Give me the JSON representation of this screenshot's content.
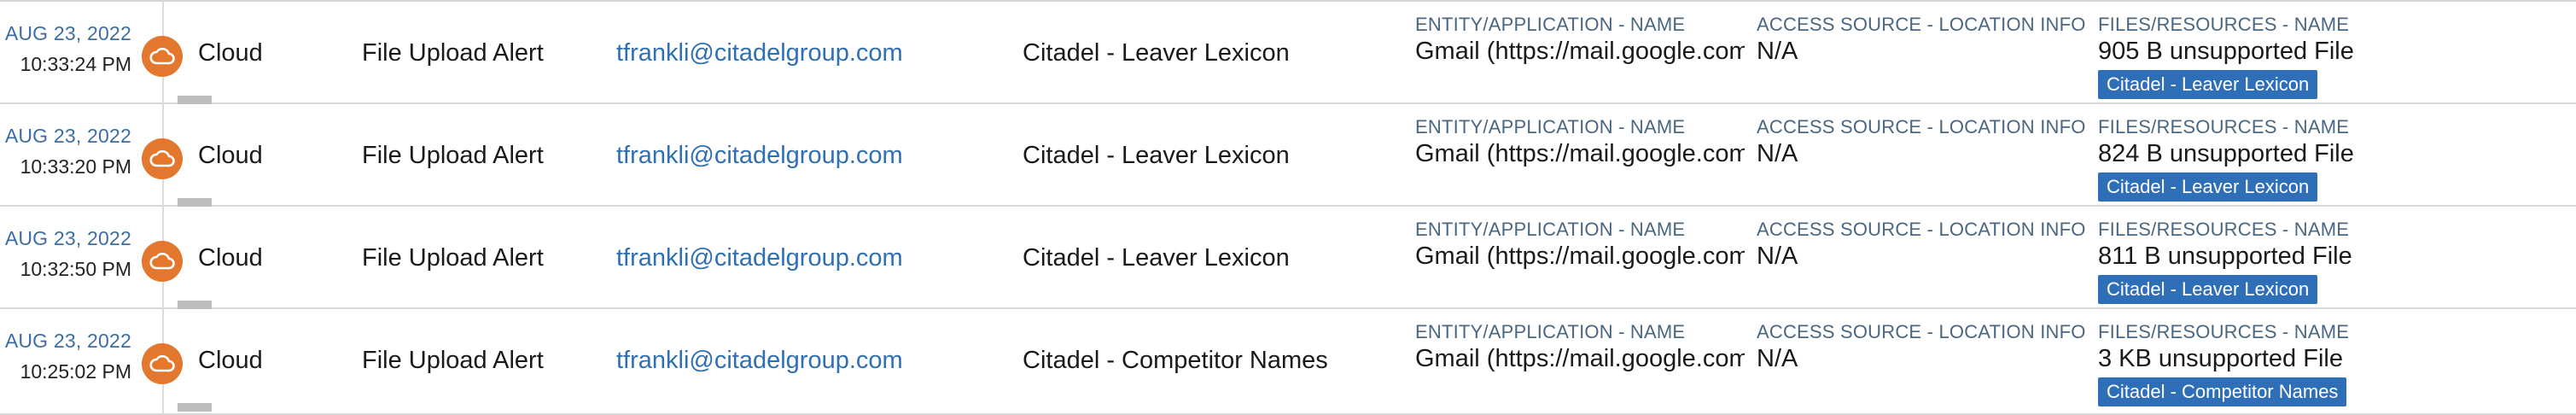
{
  "columns": {
    "entity_label": "ENTITY/APPLICATION - NAME",
    "access_label": "ACCESS SOURCE - LOCATION INFO",
    "files_label": "FILES/RESOURCES - NAME"
  },
  "colors": {
    "source_icon": "#e2772d",
    "date_text": "#3d6ea3",
    "link": "#2f6fb3",
    "tag_bg": "#2f6fb8",
    "field_label": "#4a6782"
  },
  "rows": [
    {
      "date": "AUG 23, 2022",
      "time": "10:33:24 PM",
      "source_icon": "cloud-icon",
      "source": "Cloud",
      "alert_type": "File Upload Alert",
      "user": "tfrankli@citadelgroup.com",
      "policy": "Citadel - Leaver Lexicon",
      "entity": "Gmail (https://mail.google.com",
      "access": "N/A",
      "file": "905 B unsupported File",
      "tag": "Citadel - Leaver Lexicon"
    },
    {
      "date": "AUG 23, 2022",
      "time": "10:33:20 PM",
      "source_icon": "cloud-icon",
      "source": "Cloud",
      "alert_type": "File Upload Alert",
      "user": "tfrankli@citadelgroup.com",
      "policy": "Citadel - Leaver Lexicon",
      "entity": "Gmail (https://mail.google.com",
      "access": "N/A",
      "file": "824 B unsupported File",
      "tag": "Citadel - Leaver Lexicon"
    },
    {
      "date": "AUG 23, 2022",
      "time": "10:32:50 PM",
      "source_icon": "cloud-icon",
      "source": "Cloud",
      "alert_type": "File Upload Alert",
      "user": "tfrankli@citadelgroup.com",
      "policy": "Citadel - Leaver Lexicon",
      "entity": "Gmail (https://mail.google.com",
      "access": "N/A",
      "file": "811 B unsupported File",
      "tag": "Citadel - Leaver Lexicon"
    },
    {
      "date": "AUG 23, 2022",
      "time": "10:25:02 PM",
      "source_icon": "cloud-icon",
      "source": "Cloud",
      "alert_type": "File Upload Alert",
      "user": "tfrankli@citadelgroup.com",
      "policy": "Citadel - Competitor Names",
      "entity": "Gmail (https://mail.google.com",
      "access": "N/A",
      "file": "3 KB unsupported File",
      "tag": "Citadel - Competitor Names"
    }
  ]
}
